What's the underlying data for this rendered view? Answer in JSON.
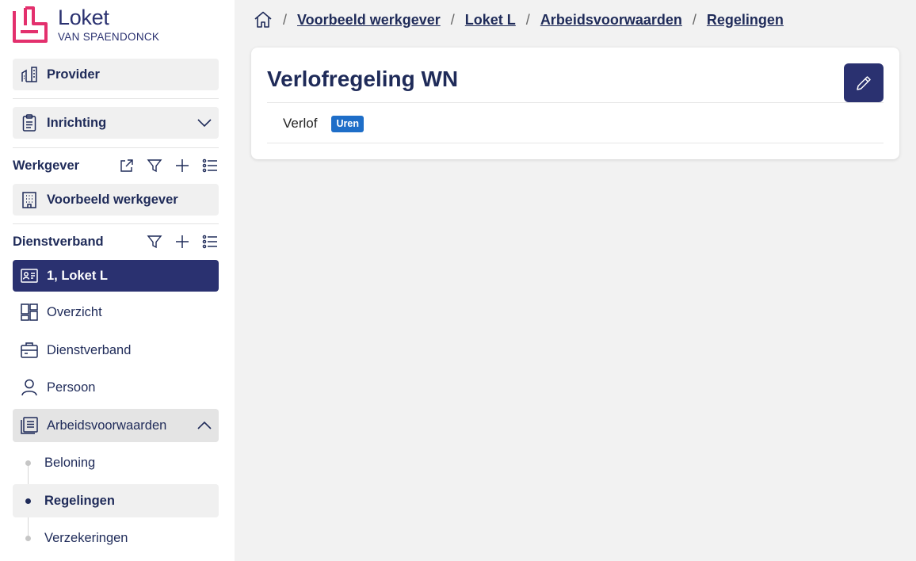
{
  "brand": {
    "title": "Loket",
    "subtitle": "VAN SPAENDONCK",
    "color": "#e3306d"
  },
  "sidebar": {
    "provider_label": "Provider",
    "inrichting_label": "Inrichting",
    "werkgever": {
      "title": "Werkgever",
      "tools": [
        "share-icon",
        "filter-icon",
        "plus-icon",
        "list-icon"
      ],
      "item_label": "Voorbeeld werkgever"
    },
    "dienstverband": {
      "title": "Dienstverband",
      "tools": [
        "filter-icon",
        "plus-icon",
        "list-icon"
      ],
      "active_label": "1, Loket L"
    },
    "nav": [
      {
        "label": "Overzicht",
        "icon": "dashboard-icon"
      },
      {
        "label": "Dienstverband",
        "icon": "briefcase-icon"
      },
      {
        "label": "Persoon",
        "icon": "person-icon"
      },
      {
        "label": "Arbeidsvoorwaarden",
        "icon": "document-list-icon",
        "expanded": true
      }
    ],
    "sub_items": [
      {
        "label": "Beloning",
        "selected": false
      },
      {
        "label": "Regelingen",
        "selected": true
      },
      {
        "label": "Verzekeringen",
        "selected": false
      }
    ]
  },
  "breadcrumb": [
    "Voorbeeld werkgever",
    "Loket L",
    "Arbeidsvoorwaarden",
    "Regelingen"
  ],
  "card": {
    "title": "Verlofregeling WN",
    "row_name": "Verlof",
    "badge": "Uren",
    "badge_color": "#1e6ec8"
  },
  "accent": "#2a3170"
}
